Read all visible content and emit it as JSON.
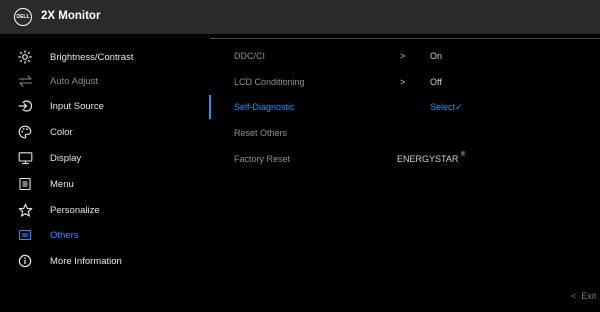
{
  "header": {
    "logo_text": "DELL",
    "title": "2X Monitor"
  },
  "menu": {
    "items": [
      {
        "label": "Brightness/Contrast",
        "icon": "brightness-icon"
      },
      {
        "label": "Auto Adjust",
        "icon": "auto-adjust-icon"
      },
      {
        "label": "Input Source",
        "icon": "input-source-icon"
      },
      {
        "label": "Color",
        "icon": "color-palette-icon"
      },
      {
        "label": "Display",
        "icon": "display-icon"
      },
      {
        "label": "Menu",
        "icon": "menu-icon"
      },
      {
        "label": "Personalize",
        "icon": "star-icon"
      },
      {
        "label": "Others",
        "icon": "others-icon"
      },
      {
        "label": "More Information",
        "icon": "info-icon"
      }
    ]
  },
  "submenu": {
    "items": [
      {
        "label": "DDC/CI",
        "chevron": ">",
        "value": "On"
      },
      {
        "label": "LCD Conditioning",
        "chevron": ">",
        "value": "Off"
      },
      {
        "label": "Self-Diagnostic",
        "value": "Select✓"
      },
      {
        "label": "Reset Others"
      },
      {
        "label": "Factory Reset",
        "value": "ENERGYSTAR",
        "value_mark": "®"
      }
    ]
  },
  "footer": {
    "exit_label": "Exit",
    "back_glyph": "<"
  },
  "colors": {
    "accent": "#2f8ff0",
    "header_bg": "#2a2a2a",
    "background": "#000000"
  }
}
